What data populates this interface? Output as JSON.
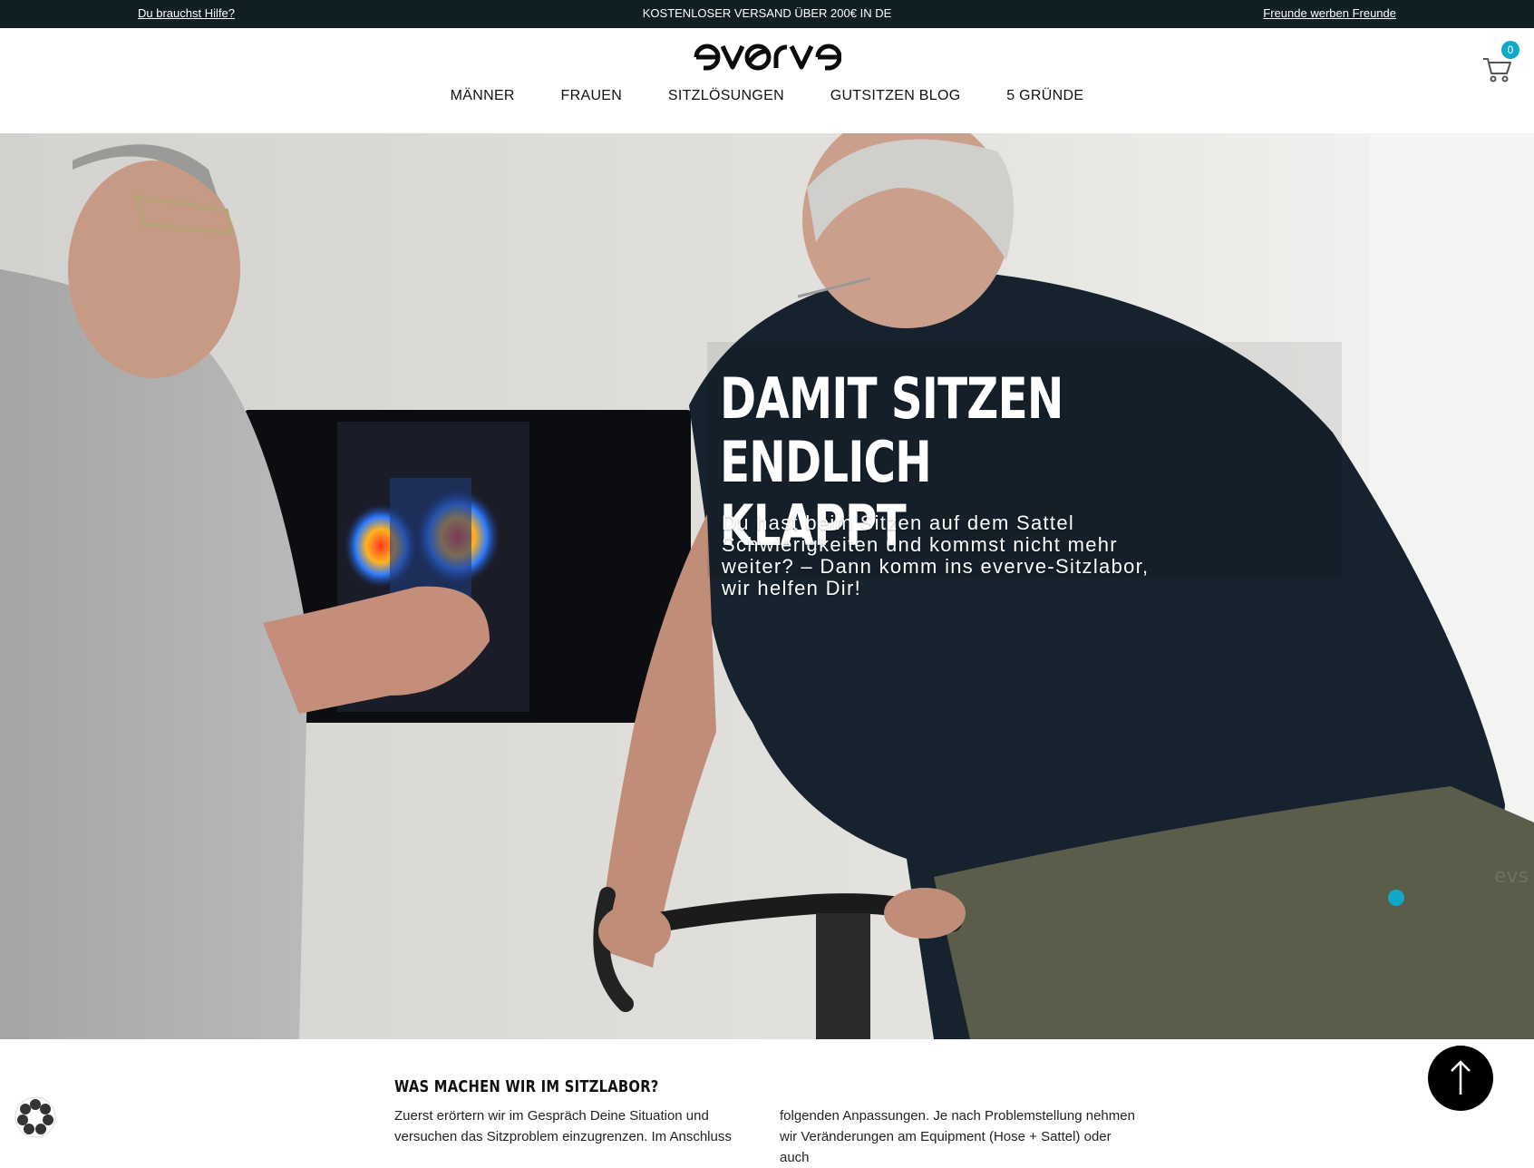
{
  "topbar": {
    "help_link": "Du brauchst Hilfe?",
    "shipping_notice": "KOSTENLOSER VERSAND ÜBER 200€ IN DE",
    "referral_link": "Freunde werben Freunde"
  },
  "header": {
    "logo_text": "everve",
    "nav": [
      "MÄNNER",
      "FRAUEN",
      "SITZLÖSUNGEN",
      "GUTSITZEN BLOG",
      "5 GRÜNDE"
    ],
    "cart_count": "0"
  },
  "hero": {
    "title_line1": "DAMIT SITZEN ENDLICH",
    "title_line2": "KLAPPT",
    "subtitle_line1": "Du hast beim Sitzen auf dem Sattel",
    "subtitle_line2": "Schwierigkeiten und kommst nicht mehr",
    "subtitle_line3": "weiter? – Dann komm ins everve-Sitzlabor,",
    "subtitle_line4": "wir helfen Dir!",
    "shorts_brand": "evs"
  },
  "section": {
    "title": "WAS MACHEN WIR IM SITZLABOR?",
    "col1_line1": "Zuerst erörtern wir im Gespräch Deine Situation und",
    "col1_line2": "versuchen das Sitzproblem einzugrenzen. Im Anschluss",
    "col2_line1": "folgenden Anpassungen. Je nach Problemstellung nehmen",
    "col2_line2": "wir Veränderungen am Equipment (Hose + Sattel) oder auch"
  },
  "colors": {
    "topbar_bg": "#0f1f24",
    "accent": "#12a8c9",
    "shirt": "#16222e",
    "shorts": "#5a5d4a"
  }
}
